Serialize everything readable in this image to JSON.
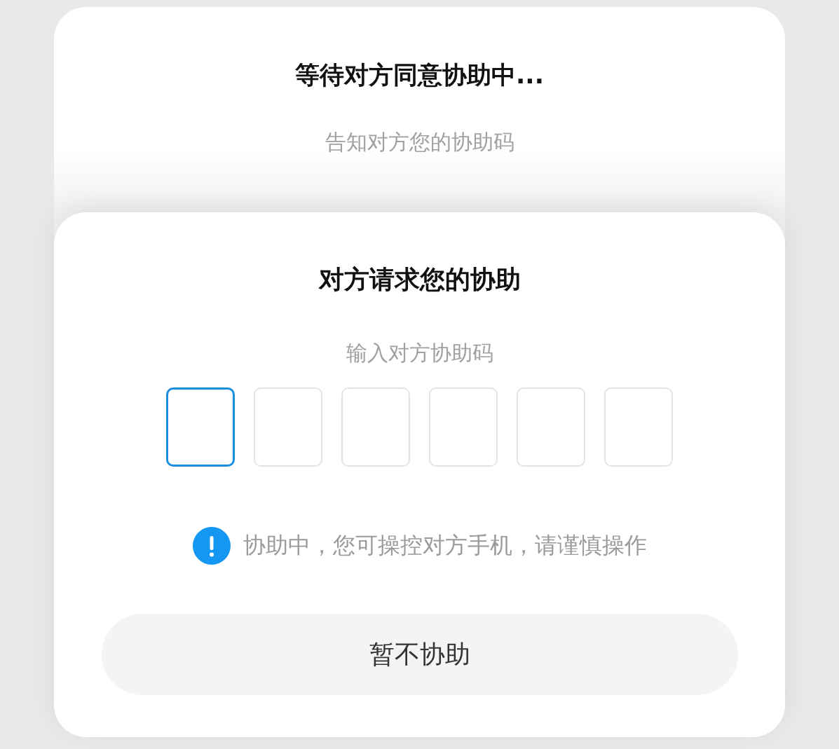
{
  "waiting_card": {
    "title": "等待对方同意协助中...",
    "subtitle": "告知对方您的协助码"
  },
  "request_card": {
    "title": "对方请求您的协助",
    "subtitle": "输入对方协助码",
    "code_boxes": [
      {
        "selected": true
      },
      {
        "selected": false
      },
      {
        "selected": false
      },
      {
        "selected": false
      },
      {
        "selected": false
      },
      {
        "selected": false
      }
    ],
    "notice": "协助中，您可操控对方手机，请谨慎操作",
    "button": "暂不协助"
  }
}
